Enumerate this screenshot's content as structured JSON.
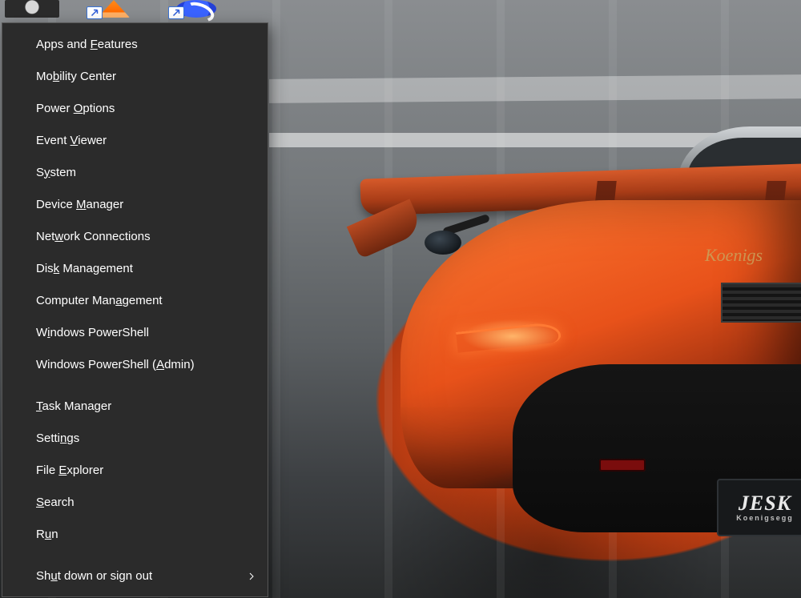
{
  "wallpaper": {
    "brand_text": "Koenigs",
    "plate_main": "JESK",
    "plate_sub": "Koenigsegg"
  },
  "desktop_icons": [
    {
      "name": "desktop-icon-image",
      "has_shortcut": false
    },
    {
      "name": "desktop-icon-vlc",
      "has_shortcut": true
    },
    {
      "name": "desktop-icon-sync",
      "has_shortcut": true
    }
  ],
  "winx_menu": {
    "groups": [
      [
        {
          "label": "Apps and Features",
          "underline_index": 9,
          "submenu": false
        },
        {
          "label": "Mobility Center",
          "underline_index": 2,
          "submenu": false
        },
        {
          "label": "Power Options",
          "underline_index": 6,
          "submenu": false
        },
        {
          "label": "Event Viewer",
          "underline_index": 6,
          "submenu": false
        },
        {
          "label": "System",
          "underline_index": 1,
          "submenu": false
        },
        {
          "label": "Device Manager",
          "underline_index": 7,
          "submenu": false
        },
        {
          "label": "Network Connections",
          "underline_index": 3,
          "submenu": false
        },
        {
          "label": "Disk Management",
          "underline_index": 3,
          "submenu": false
        },
        {
          "label": "Computer Management",
          "underline_index": 12,
          "submenu": false
        },
        {
          "label": "Windows PowerShell",
          "underline_index": 1,
          "submenu": false
        },
        {
          "label": "Windows PowerShell (Admin)",
          "underline_index": 20,
          "submenu": false
        }
      ],
      [
        {
          "label": "Task Manager",
          "underline_index": 0,
          "submenu": false
        },
        {
          "label": "Settings",
          "underline_index": 5,
          "submenu": false
        },
        {
          "label": "File Explorer",
          "underline_index": 5,
          "submenu": false
        },
        {
          "label": "Search",
          "underline_index": 0,
          "submenu": false
        },
        {
          "label": "Run",
          "underline_index": 1,
          "submenu": false
        }
      ],
      [
        {
          "label": "Shut down or sign out",
          "underline_index": 2,
          "submenu": true
        }
      ]
    ]
  }
}
